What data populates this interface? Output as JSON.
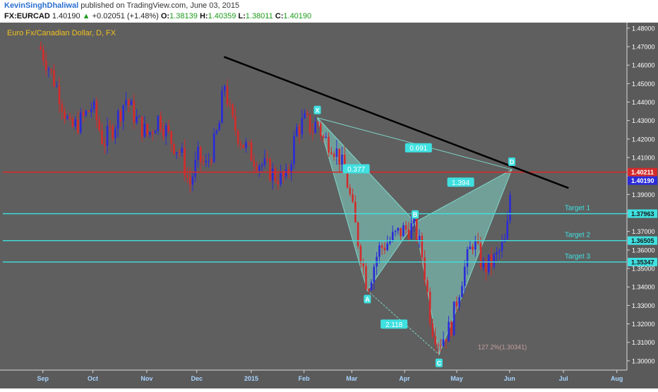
{
  "header": {
    "author": "KevinSinghDhaliwal",
    "published": "published on TradingView.com, June 03, 2015",
    "symbol": "FX:EURCAD",
    "last": "1.40190",
    "change": "+0.02051 (+1.48%)",
    "ohlc": [
      {
        "label": "O:",
        "value": "1.38139"
      },
      {
        "label": "H:",
        "value": "1.40359"
      },
      {
        "label": "L:",
        "value": "1.38011"
      },
      {
        "label": "C:",
        "value": "1.40190"
      }
    ]
  },
  "colors": {
    "background": "#5f5f5f",
    "up_candle": "#2b2bd9",
    "down_candle": "#d42b2b",
    "trendline": "#000000",
    "resistance": "#d42b2b",
    "target": "#3fe0e0",
    "pattern_fill": "#7fd6c8",
    "axis_text": "#ffffff",
    "title_text": "#f0c020"
  },
  "chart_data": {
    "type": "candlestick",
    "title": "Euro Fx/Canadian Dollar, D, FX",
    "ylim": [
      1.295,
      1.483
    ],
    "y_ticks": [
      1.48,
      1.47,
      1.46,
      1.45,
      1.44,
      1.43,
      1.42,
      1.41,
      1.4,
      1.39,
      1.38,
      1.37,
      1.36,
      1.35,
      1.34,
      1.33,
      1.32,
      1.31,
      1.3
    ],
    "x_ticks": [
      {
        "label": "Sep",
        "t": 0.06
      },
      {
        "label": "Oct",
        "t": 0.96
      },
      {
        "label": "Nov",
        "t": 1.93
      },
      {
        "label": "Dec",
        "t": 2.83
      },
      {
        "label": "2015",
        "t": 3.81
      },
      {
        "label": "Feb",
        "t": 4.76
      },
      {
        "label": "Mar",
        "t": 5.62
      },
      {
        "label": "Apr",
        "t": 6.57
      },
      {
        "label": "May",
        "t": 7.51
      },
      {
        "label": "Jun",
        "t": 8.46
      },
      {
        "label": "Jul",
        "t": 9.43
      },
      {
        "label": "Aug",
        "t": 10.39
      }
    ],
    "price_labels": [
      {
        "value": 1.40211,
        "text": "1.40211",
        "color": "#d42b2b"
      },
      {
        "value": 1.4019,
        "text": "1.40190",
        "color": "#2b2bd9"
      },
      {
        "value": 1.37963,
        "text": "1.37963",
        "color": "#3fe0e0"
      },
      {
        "value": 1.36505,
        "text": "1.36505",
        "color": "#3fe0e0"
      },
      {
        "value": 1.35347,
        "text": "1.35347",
        "color": "#3fe0e0"
      }
    ],
    "horizontal_lines": [
      {
        "name": "resistance",
        "value": 1.4021,
        "color": "#d42b2b"
      },
      {
        "name": "Target 1",
        "value": 1.37963,
        "color": "#3fe0e0",
        "label": "Target 1"
      },
      {
        "name": "Target 2",
        "value": 1.36505,
        "color": "#3fe0e0",
        "label": "Target 2"
      },
      {
        "name": "Target 3",
        "value": 1.35347,
        "color": "#3fe0e0",
        "label": "Target 3"
      }
    ],
    "trendline": [
      {
        "t": 3.32,
        "price": 1.4645
      },
      {
        "t": 9.52,
        "price": 1.3935
      }
    ],
    "pattern_points": [
      {
        "label": "X",
        "t": 5.0,
        "price": 1.4315
      },
      {
        "label": "A",
        "t": 5.9,
        "price": 1.338
      },
      {
        "label": "B",
        "t": 6.76,
        "price": 1.375
      },
      {
        "label": "C",
        "t": 7.19,
        "price": 1.3035
      },
      {
        "label": "D",
        "t": 8.5,
        "price": 1.4035
      }
    ],
    "ratios": [
      {
        "text": "0.691",
        "t": 6.82,
        "price": 1.4151
      },
      {
        "text": "0.377",
        "t": 5.7,
        "price": 1.4037
      },
      {
        "text": "1.394",
        "t": 7.58,
        "price": 1.3965
      },
      {
        "text": "2.118",
        "t": 6.38,
        "price": 1.3197
      }
    ],
    "annotation": {
      "text": "127.2%(1.30341)",
      "t": 8.33,
      "price": 1.3063
    },
    "candle_path": [
      [
        0.0,
        1.47
      ],
      [
        0.15,
        1.46
      ],
      [
        0.35,
        1.445
      ],
      [
        0.55,
        1.425
      ],
      [
        0.75,
        1.43
      ],
      [
        0.95,
        1.438
      ],
      [
        1.15,
        1.418
      ],
      [
        1.35,
        1.428
      ],
      [
        1.55,
        1.442
      ],
      [
        1.75,
        1.43
      ],
      [
        1.95,
        1.422
      ],
      [
        2.15,
        1.432
      ],
      [
        2.35,
        1.42
      ],
      [
        2.55,
        1.412
      ],
      [
        2.7,
        1.395
      ],
      [
        2.85,
        1.41
      ],
      [
        3.0,
        1.405
      ],
      [
        3.15,
        1.418
      ],
      [
        3.25,
        1.43
      ],
      [
        3.32,
        1.452
      ],
      [
        3.45,
        1.43
      ],
      [
        3.65,
        1.418
      ],
      [
        3.85,
        1.41
      ],
      [
        4.05,
        1.405
      ],
      [
        4.25,
        1.4
      ],
      [
        4.45,
        1.398
      ],
      [
        4.62,
        1.425
      ],
      [
        4.78,
        1.43
      ],
      [
        4.92,
        1.425
      ],
      [
        5.0,
        1.43
      ],
      [
        5.1,
        1.42
      ],
      [
        5.25,
        1.418
      ],
      [
        5.4,
        1.41
      ],
      [
        5.55,
        1.395
      ],
      [
        5.7,
        1.37
      ],
      [
        5.9,
        1.34
      ],
      [
        6.1,
        1.36
      ],
      [
        6.3,
        1.365
      ],
      [
        6.5,
        1.37
      ],
      [
        6.65,
        1.372
      ],
      [
        6.76,
        1.372
      ],
      [
        6.9,
        1.355
      ],
      [
        7.05,
        1.32
      ],
      [
        7.19,
        1.31
      ],
      [
        7.4,
        1.318
      ],
      [
        7.6,
        1.345
      ],
      [
        7.8,
        1.365
      ],
      [
        8.0,
        1.35
      ],
      [
        8.2,
        1.355
      ],
      [
        8.4,
        1.365
      ],
      [
        8.5,
        1.4019
      ]
    ]
  }
}
